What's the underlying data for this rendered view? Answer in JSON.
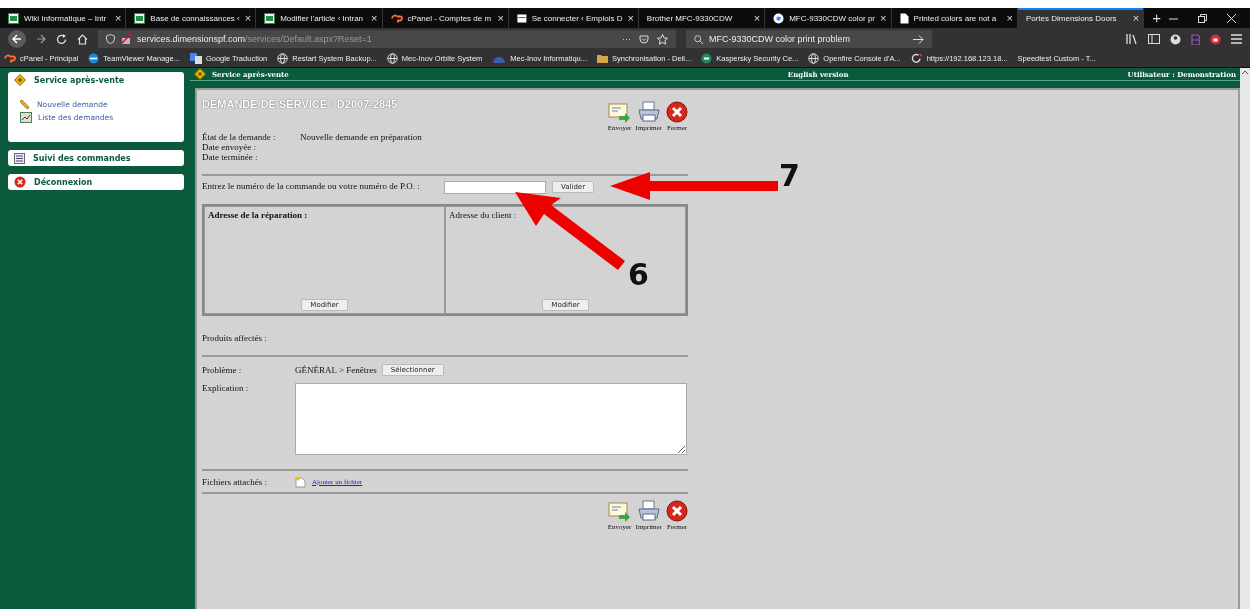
{
  "browser": {
    "tabs": [
      {
        "title": "Wiki Informatique – Intr",
        "close": "×",
        "selected": false
      },
      {
        "title": "Base de connaissances ‹",
        "close": "×",
        "selected": false
      },
      {
        "title": "Modifier l'article ‹ Intran",
        "close": "×",
        "selected": false
      },
      {
        "title": "cPanel - Comptes de m",
        "close": "×",
        "selected": false
      },
      {
        "title": "Se connecter ‹ Emplois D",
        "close": "×",
        "selected": false
      },
      {
        "title": "Brother MFC-9330CDW",
        "close": "×",
        "selected": false
      },
      {
        "title": "MFC-9330CDW color pr",
        "close": "×",
        "selected": false
      },
      {
        "title": "Printed colors are not a",
        "close": "×",
        "selected": false
      },
      {
        "title": "Portes Dimensions Doors",
        "close": "×",
        "selected": true
      }
    ],
    "new_tab": "+",
    "address": {
      "host": "services.dimensionspf.com",
      "path": "/services/Default.aspx?Reset=1"
    },
    "page_actions": "···",
    "search": {
      "value": "MFC-9330CDW color print problem"
    },
    "bookmarks": [
      "cPanel - Principal",
      "TeamViewer Manage...",
      "Google Traduction",
      "Restart System Backup...",
      "Mec-Inov Orbite System",
      "Mec-Inov Informatiqu...",
      "Synchronisation - Deli...",
      "Kaspersky Security Ce...",
      "Openfire Console d'A...",
      "https://192.168.123.18...",
      "Speedtest Custom - T..."
    ]
  },
  "sidebar": {
    "sections": [
      {
        "title": "Service après-vente",
        "links": [
          "Nouvelle demande",
          "Liste des demandes"
        ]
      },
      {
        "title": "Suivi des commandes"
      },
      {
        "title": "Déconnexion"
      }
    ]
  },
  "header": {
    "left": "Service après-vente",
    "center": "English version",
    "right": "Utilisateur : Demonstration"
  },
  "form": {
    "title": "DEMANDE DE SERVICE : D2007-2845",
    "actions": [
      {
        "label": "Envoyer",
        "kind": "send"
      },
      {
        "label": "Imprimer",
        "kind": "print"
      },
      {
        "label": "Fermer",
        "kind": "close"
      }
    ],
    "status": [
      {
        "label": "État de la demande :",
        "value": "Nouvelle demande en préparation"
      },
      {
        "label": "Date envoyée :"
      },
      {
        "label": "Date terminée :"
      }
    ],
    "order": {
      "label": "Entrez le numéro de la commande ou votre numéro de P.O. :",
      "button": "Valider"
    },
    "addresses": [
      {
        "label": "Adresse de la réparation :",
        "button": "Modifier"
      },
      {
        "label": "Adresse du client :",
        "button": "Modifier"
      }
    ],
    "products_label": "Produits affectés :",
    "problem": {
      "label": "Problème :",
      "value": "GÉNÉRAL > Fenêtres",
      "button": "Sélectionner"
    },
    "explanation": {
      "label": "Explication :"
    },
    "files": {
      "label": "Fichiers attachés :",
      "link": "Ajouter un fichier"
    },
    "bottom_actions": [
      {
        "label": "Envoyer",
        "kind": "send"
      },
      {
        "label": "Imprimer",
        "kind": "print"
      },
      {
        "label": "Fermer",
        "kind": "close"
      }
    ]
  },
  "annotations": [
    {
      "label": "7",
      "kind": "horizontal"
    },
    {
      "label": "6",
      "kind": "diagonal"
    }
  ]
}
